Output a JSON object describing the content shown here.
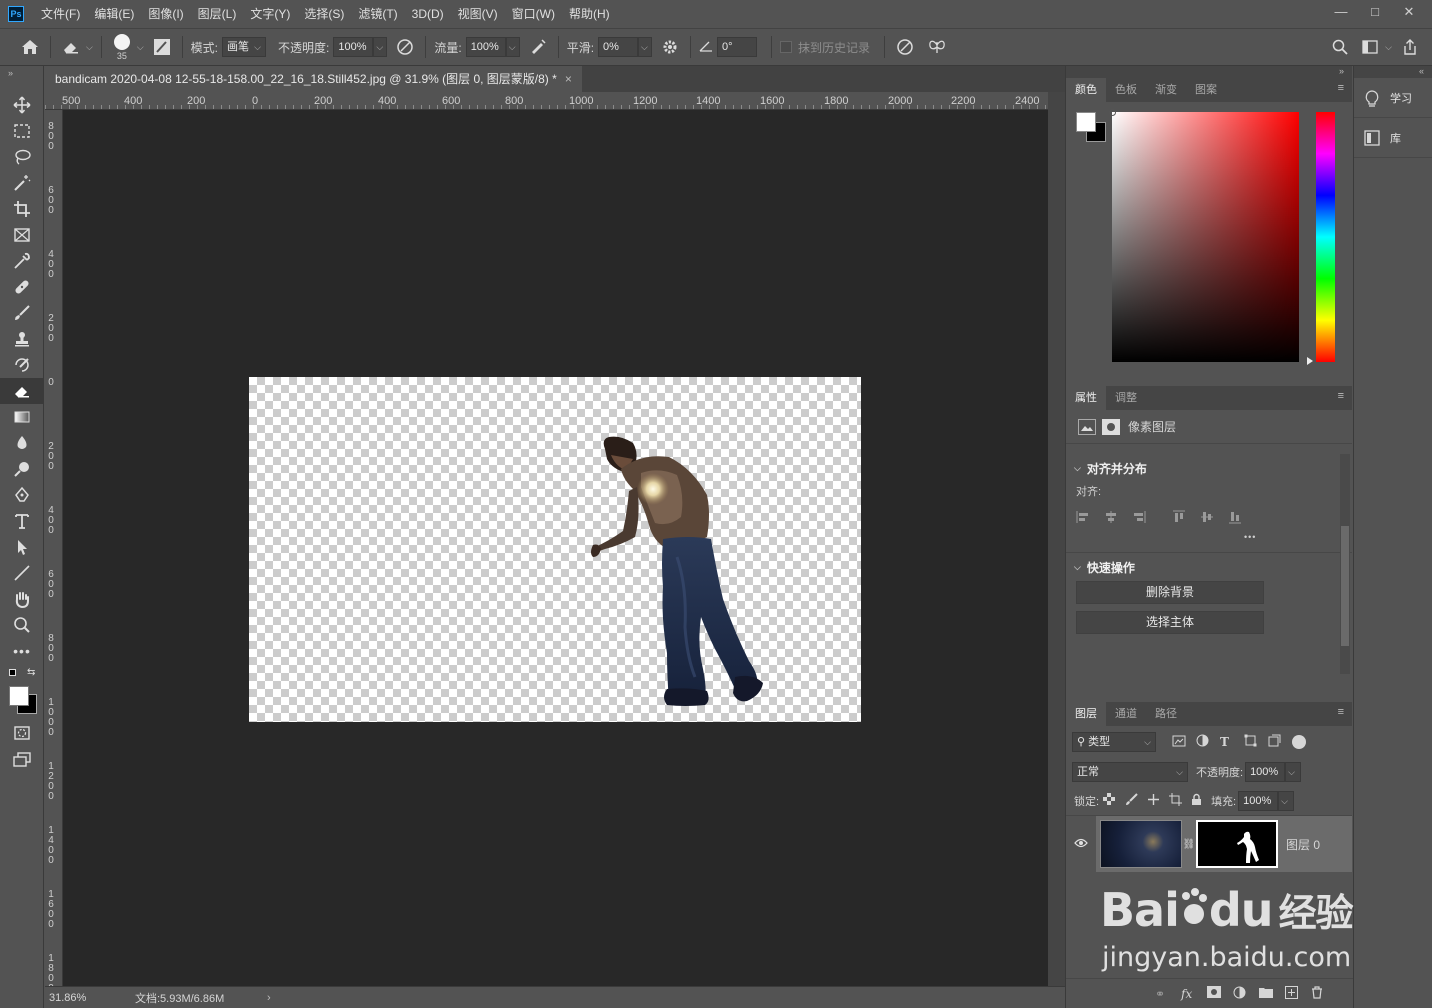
{
  "app": {
    "logo_text": "Ps"
  },
  "menu": [
    "文件(F)",
    "编辑(E)",
    "图像(I)",
    "图层(L)",
    "文字(Y)",
    "选择(S)",
    "滤镜(T)",
    "3D(D)",
    "视图(V)",
    "窗口(W)",
    "帮助(H)"
  ],
  "window_controls": {
    "minimize": "—",
    "maximize": "□",
    "close": "✕"
  },
  "options": {
    "brush_size": "35",
    "mode_label": "模式:",
    "mode_value": "画笔",
    "opacity_label": "不透明度:",
    "opacity_value": "100%",
    "flow_label": "流量:",
    "flow_value": "100%",
    "smooth_label": "平滑:",
    "smooth_value": "0%",
    "angle_value": "0°",
    "erase_history_label": "抹到历史记录"
  },
  "document": {
    "tab_title": "bandicam 2020-04-08 12-55-18-158.00_22_16_18.Still452.jpg @ 31.9% (图层 0, 图层蒙版/8) *",
    "close": "×"
  },
  "rulers": {
    "horizontal": [
      "500",
      "400",
      "200",
      "0",
      "200",
      "400",
      "600",
      "800",
      "1000",
      "1200",
      "1400",
      "1600",
      "1800",
      "2000",
      "2200",
      "2400"
    ],
    "vertical": [
      "800",
      "600",
      "400",
      "200",
      "0",
      "200",
      "400",
      "600",
      "800",
      "1000",
      "1200",
      "1400",
      "1600",
      "1800"
    ]
  },
  "status": {
    "zoom": "31.86%",
    "doc_size": "文档:5.93M/6.86M",
    "arrow": "›"
  },
  "color_panel": {
    "tabs": [
      "颜色",
      "色板",
      "渐变",
      "图案"
    ],
    "active_tab": 0,
    "foreground": "#ffffff",
    "background": "#000000",
    "hue": "#ff0000"
  },
  "properties_panel": {
    "tabs": [
      "属性",
      "调整"
    ],
    "active_tab": 0,
    "layer_type": "像素图层",
    "align_section": "对齐并分布",
    "align_label": "对齐:",
    "more": "•••",
    "quick_section": "快速操作",
    "remove_bg": "删除背景",
    "select_subject": "选择主体"
  },
  "layers_panel": {
    "tabs": [
      "图层",
      "通道",
      "路径"
    ],
    "active_tab": 0,
    "filter_kind": "类型",
    "blend_mode": "正常",
    "opacity_label": "不透明度:",
    "opacity_value": "100%",
    "lock_label": "锁定:",
    "fill_label": "填充:",
    "fill_value": "100%",
    "layers": [
      {
        "name": "图层 0",
        "visible": true,
        "has_mask": true
      }
    ],
    "footer_icons": [
      "link-icon",
      "fx-icon",
      "mask-icon",
      "adjustment-icon",
      "folder-icon",
      "new-layer-icon",
      "trash-icon"
    ],
    "fx_label": "fx"
  },
  "dock": {
    "learn": "学习",
    "library": "库"
  },
  "watermark": {
    "line1": "Bai",
    "line1b": "du",
    "line1c": "经验",
    "line2": "jingyan.baidu.com"
  }
}
